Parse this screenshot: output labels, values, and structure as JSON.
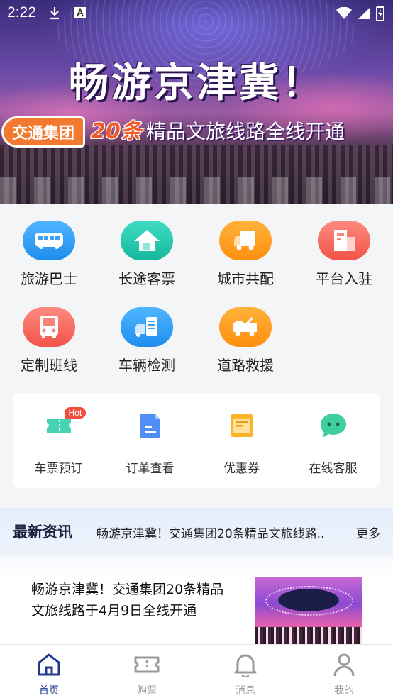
{
  "status_bar": {
    "time": "2:22"
  },
  "banner": {
    "headline": "畅游京津冀！",
    "tag": "交通集团",
    "number": "20条",
    "subtitle": "精品文旅线路全线开通"
  },
  "services": [
    {
      "label": "旅游巴士",
      "icon": "bus-icon",
      "color": "#1f8df0"
    },
    {
      "label": "长途客票",
      "icon": "house-icon",
      "color": "#14b89c"
    },
    {
      "label": "城市共配",
      "icon": "truck-icon",
      "color": "#ff8f10"
    },
    {
      "label": "平台入驻",
      "icon": "building-icon",
      "color": "#f2534a"
    },
    {
      "label": "定制班线",
      "icon": "bus-front-icon",
      "color": "#f2534a"
    },
    {
      "label": "车辆检测",
      "icon": "car-inspect-icon",
      "color": "#1f8df0"
    },
    {
      "label": "道路救援",
      "icon": "tow-truck-icon",
      "color": "#ff8f10"
    }
  ],
  "quick": [
    {
      "label": "车票预订",
      "icon": "ticket-icon",
      "badge": "Hot"
    },
    {
      "label": "订单查看",
      "icon": "document-icon"
    },
    {
      "label": "优惠券",
      "icon": "coupon-icon"
    },
    {
      "label": "在线客服",
      "icon": "chat-icon"
    }
  ],
  "news": {
    "title": "最新资讯",
    "ticker": "畅游京津冀！交通集团20条精品文旅线路",
    "more": "更多",
    "item_text": "畅游京津冀！交通集团20条精品文旅线路于4月9日全线开通"
  },
  "tabs": [
    {
      "label": "首页",
      "icon": "home-icon",
      "active": true
    },
    {
      "label": "购票",
      "icon": "ticket-tab-icon"
    },
    {
      "label": "消息",
      "icon": "bell-icon"
    },
    {
      "label": "我的",
      "icon": "user-icon"
    }
  ],
  "colors": {
    "accent": "#1f3a8f",
    "hot_badge": "#f04e3e"
  }
}
